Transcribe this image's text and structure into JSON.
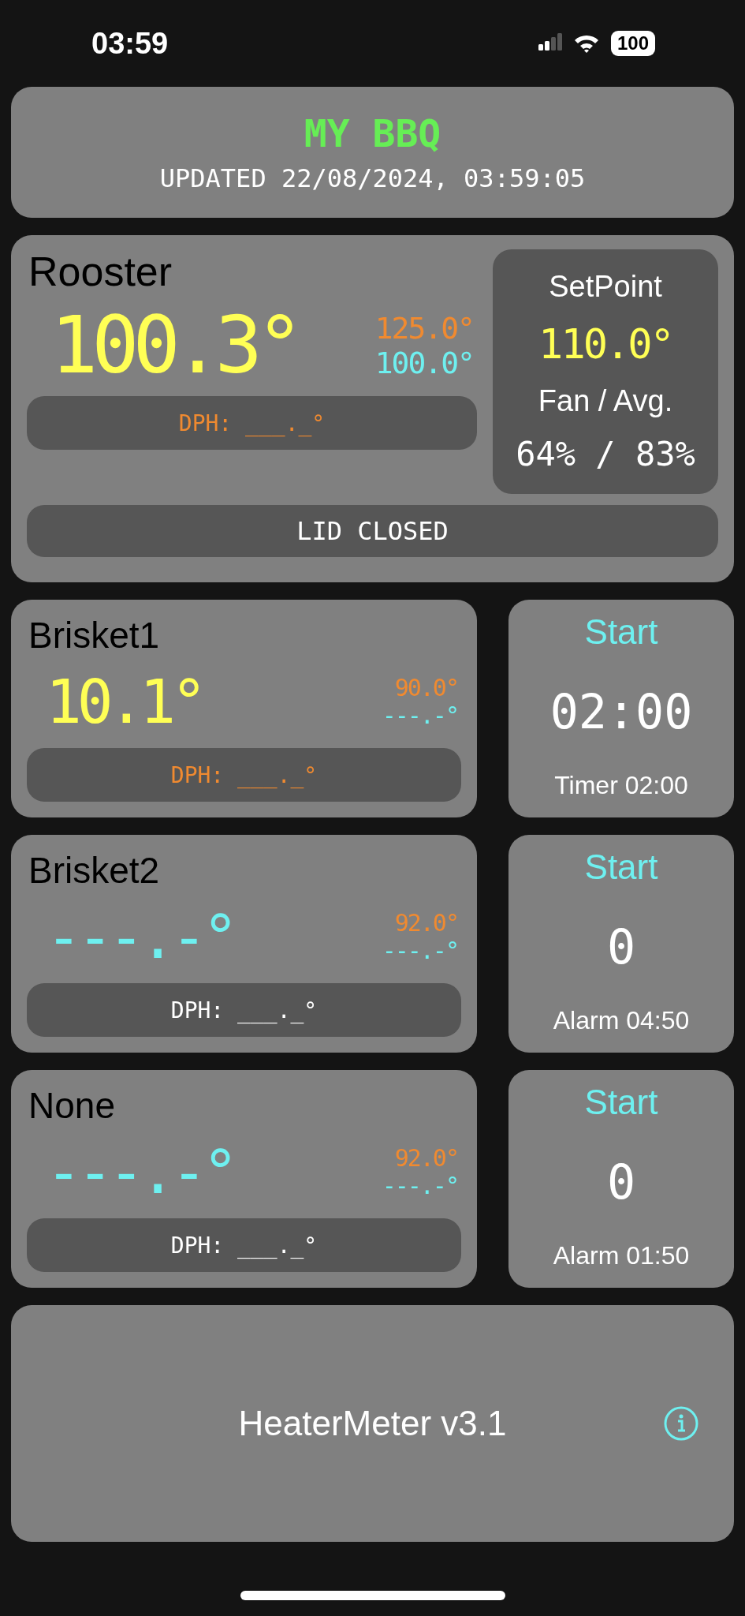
{
  "status_bar": {
    "time": "03:59",
    "battery": "100"
  },
  "header": {
    "title": "MY BBQ",
    "updated": "UPDATED 22/08/2024, 03:59:05"
  },
  "pit": {
    "name": "Rooster",
    "temp": {
      "text": "100.3°",
      "color": "#ffff55"
    },
    "high": "125.0°",
    "low": "100.0°",
    "dph": {
      "text": "DPH: ___._°",
      "color": "#f08a30"
    },
    "setpoint_label": "SetPoint",
    "setpoint": "110.0°",
    "fan_label": "Fan / Avg.",
    "fan": "64% / 83%",
    "lid": "LID CLOSED"
  },
  "probes": [
    {
      "name": "Brisket1",
      "temp": {
        "text": "10.1°",
        "color": "#ffff55"
      },
      "high": "90.0°",
      "low": "---.-°",
      "dph": {
        "text": "DPH: ___._°",
        "color": "#f08a30"
      },
      "timer": {
        "action": "Start",
        "value": "02:00",
        "label": "Timer 02:00"
      }
    },
    {
      "name": "Brisket2",
      "temp": {
        "text": "---.-°",
        "color": "#6ef0f0"
      },
      "high": "92.0°",
      "low": "---.-°",
      "dph": {
        "text": "DPH: ___._°",
        "color": "#ffffff"
      },
      "timer": {
        "action": "Start",
        "value": "0",
        "label": "Alarm 04:50"
      }
    },
    {
      "name": "None",
      "temp": {
        "text": "---.-°",
        "color": "#6ef0f0"
      },
      "high": "92.0°",
      "low": "---.-°",
      "dph": {
        "text": "DPH: ___._°",
        "color": "#ffffff"
      },
      "timer": {
        "action": "Start",
        "value": "0",
        "label": "Alarm 01:50"
      }
    }
  ],
  "footer": {
    "text": "HeaterMeter v3.1"
  }
}
